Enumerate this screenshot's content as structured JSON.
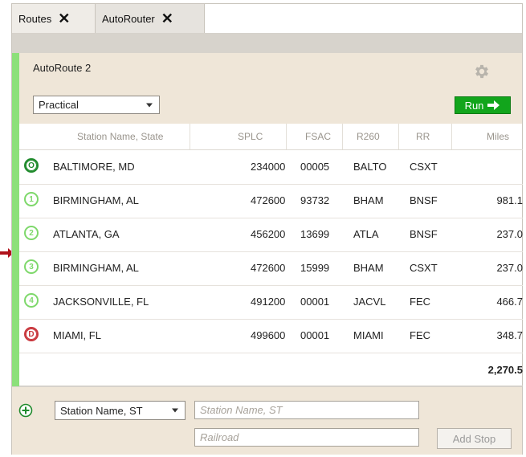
{
  "tabs": [
    {
      "label": "Routes",
      "close": "✕"
    },
    {
      "label": "AutoRouter",
      "close": "✕"
    }
  ],
  "route": {
    "name": "AutoRoute 2",
    "routing_type": "Practical",
    "run_label": "Run"
  },
  "table": {
    "headers": [
      "Station Name, State",
      "SPLC",
      "FSAC",
      "R260",
      "RR",
      "Miles"
    ],
    "rows": [
      {
        "badge": "O",
        "station": "BALTIMORE, MD",
        "splc": "234000",
        "fsac": "00005",
        "r260": "BALTO",
        "rr": "CSXT",
        "miles": ""
      },
      {
        "badge": "1",
        "station": "BIRMINGHAM, AL",
        "splc": "472600",
        "fsac": "93732",
        "r260": "BHAM",
        "rr": "BNSF",
        "miles": "981.1"
      },
      {
        "badge": "2",
        "station": "ATLANTA, GA",
        "splc": "456200",
        "fsac": "13699",
        "r260": "ATLA",
        "rr": "BNSF",
        "miles": "237.0"
      },
      {
        "badge": "3",
        "station": "BIRMINGHAM, AL",
        "splc": "472600",
        "fsac": "15999",
        "r260": "BHAM",
        "rr": "CSXT",
        "miles": "237.0"
      },
      {
        "badge": "4",
        "station": "JACKSONVILLE, FL",
        "splc": "491200",
        "fsac": "00001",
        "r260": "JACVL",
        "rr": "FEC",
        "miles": "466.7"
      },
      {
        "badge": "D",
        "station": "MIAMI, FL",
        "splc": "499600",
        "fsac": "00001",
        "r260": "MIAMI",
        "rr": "FEC",
        "miles": "348.7"
      }
    ],
    "total_miles": "2,270.5"
  },
  "footer": {
    "search_type": "Station Name, ST",
    "station_placeholder": "Station Name, ST",
    "railroad_placeholder": "Railroad",
    "add_stop_label": "Add Stop"
  },
  "colors": {
    "accent_green": "#8ce07a",
    "run_green": "#12a51c",
    "origin": "#1f8a2c",
    "destination": "#c9373d",
    "pointer_arrow": "#b0121b"
  },
  "icons": {
    "tab_close": "close-icon",
    "settings": "gear-icon",
    "run": "arrow-right-icon",
    "add": "plus-circle-icon",
    "pointer": "arrow-pointer-icon"
  }
}
